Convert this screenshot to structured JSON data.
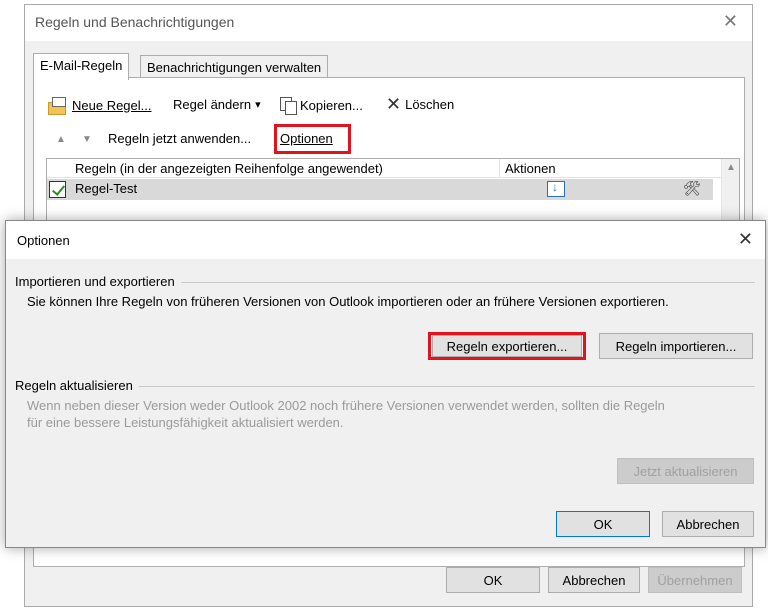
{
  "main_window": {
    "title": "Regeln und Benachrichtigungen",
    "close_glyph": "✕",
    "tabs": [
      {
        "label": "E-Mail-Regeln"
      },
      {
        "label": "Benachrichtigungen verwalten"
      }
    ],
    "toolbar": {
      "new_rule": "Neue Regel...",
      "change_rule": "Regel ändern",
      "change_rule_arrow": "▾",
      "copy": "Kopieren...",
      "delete": "Löschen",
      "apply_now": "Regeln jetzt anwenden...",
      "options": "Optionen",
      "move_up_glyph": "▲",
      "move_down_glyph": "▼"
    },
    "list": {
      "col_rules": "Regeln (in der angezeigten Reihenfolge angewendet)",
      "col_actions": "Aktionen",
      "rows": [
        {
          "name": "Regel-Test",
          "checked": true,
          "tools_glyph": "🛠"
        }
      ],
      "scroll_up_glyph": "▲"
    },
    "buttons": {
      "ok": "OK",
      "cancel": "Abbrechen",
      "apply": "Übernehmen"
    }
  },
  "options_dialog": {
    "title": "Optionen",
    "close_glyph": "✕",
    "import_export": {
      "heading": "Importieren und exportieren",
      "description": "Sie können Ihre Regeln von früheren Versionen von Outlook importieren oder an frühere Versionen exportieren.",
      "export_button": "Regeln exportieren...",
      "import_button": "Regeln importieren..."
    },
    "update": {
      "heading": "Regeln aktualisieren",
      "description_line1": "Wenn neben dieser Version weder Outlook 2002 noch frühere Versionen verwendet werden, sollten die Regeln",
      "description_line2": "für eine bessere Leistungsfähigkeit aktualisiert werden.",
      "update_button": "Jetzt aktualisieren"
    },
    "buttons": {
      "ok": "OK",
      "cancel": "Abbrechen"
    }
  },
  "highlight_color": "#e0141e"
}
